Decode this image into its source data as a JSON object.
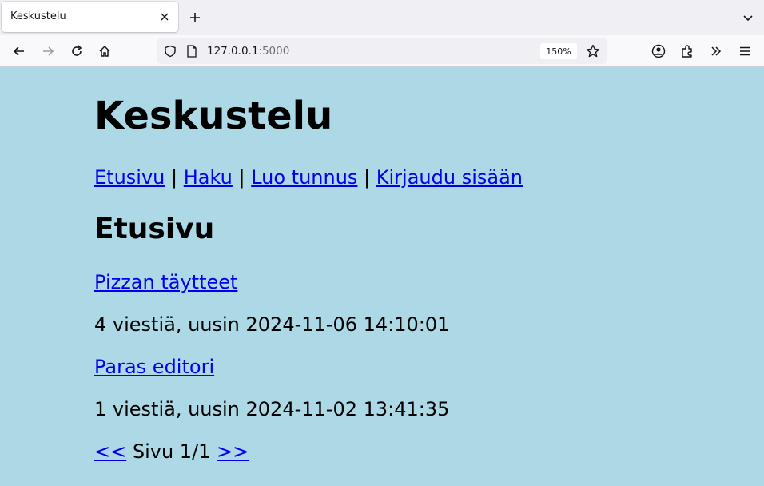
{
  "browser": {
    "tab_title": "Keskustelu",
    "url_host": "127.0.0.1",
    "url_port": ":5000",
    "zoom": "150%"
  },
  "page": {
    "site_title": "Keskustelu",
    "nav": {
      "home": "Etusivu",
      "search": "Haku",
      "register": "Luo tunnus",
      "login": "Kirjaudu sisään",
      "separator": " | "
    },
    "section_title": "Etusivu",
    "threads": [
      {
        "title": "Pizzan täytteet",
        "info": "4 viestiä, uusin 2024-11-06 14:10:01"
      },
      {
        "title": "Paras editori",
        "info": "1 viestiä, uusin 2024-11-02 13:41:35"
      }
    ],
    "pagination": {
      "prev": "<<",
      "status": " Sivu 1/1 ",
      "next": ">>"
    }
  }
}
